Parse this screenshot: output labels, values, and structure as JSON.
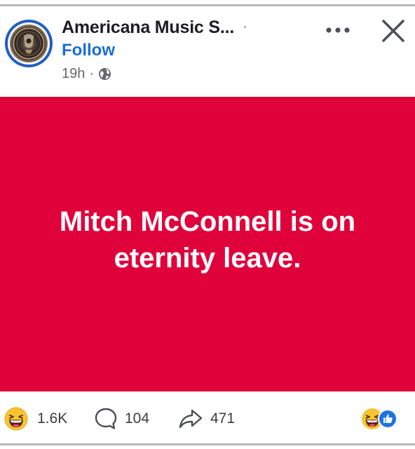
{
  "post": {
    "page_name": "Americana Music S...",
    "name_separator": "·",
    "follow_label": "Follow",
    "timestamp": "19h",
    "meta_separator": "·",
    "audience_icon": "globe-icon",
    "body_text": "Mitch McConnell is on eternity leave.",
    "background_color": "#e0033b",
    "text_color": "#ffffff"
  },
  "header_actions": {
    "more_icon": "more-horizontal-icon",
    "close_icon": "close-icon"
  },
  "engagement": {
    "reaction_icon": "laugh-reaction-icon",
    "reaction_count": "1.6K",
    "comment_icon": "comment-icon",
    "comment_count": "104",
    "share_icon": "share-icon",
    "share_count": "471",
    "summary_icons": [
      "laugh-reaction-icon",
      "like-reaction-icon"
    ]
  },
  "colors": {
    "accent_blue": "#1b6ed6",
    "avatar_ring": "#1f5dc7",
    "secondary_text": "#65676b"
  }
}
